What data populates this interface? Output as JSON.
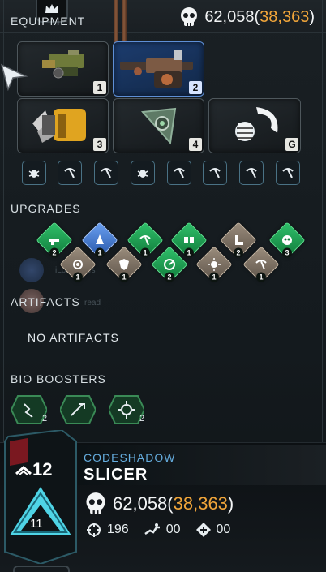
{
  "header": {
    "equipment_title": "EQUIPMENT",
    "currency_main": "62,058",
    "currency_paren_open": "(",
    "currency_secondary": "38,363",
    "currency_paren_close": ")"
  },
  "equipment": {
    "slots": [
      {
        "num": "1",
        "name": "primary-weapon",
        "selected": false
      },
      {
        "num": "2",
        "name": "secondary-weapon",
        "selected": true
      },
      {
        "num": "3",
        "name": "support-equipment",
        "selected": false
      },
      {
        "num": "4",
        "name": "throwable-equipment",
        "selected": false
      },
      {
        "num": "G",
        "name": "grenade",
        "selected": false
      }
    ],
    "mods": [
      "bug-mod-icon",
      "pickaxe-mod-icon",
      "pickaxe-mod-icon",
      "bug-mod-icon",
      "pickaxe-mod-icon",
      "pickaxe-mod-icon",
      "pickaxe-mod-icon",
      "pickaxe-mod-icon"
    ]
  },
  "upgrades": {
    "title": "UPGRADES",
    "items": [
      {
        "color": "green",
        "count": "2"
      },
      {
        "color": "blue",
        "count": "1"
      },
      {
        "color": "green",
        "count": "1"
      },
      {
        "color": "green",
        "count": "1"
      },
      {
        "color": "tan",
        "count": "2"
      },
      {
        "color": "green",
        "count": "3"
      },
      {
        "color": "tan",
        "count": "1"
      },
      {
        "color": "tan",
        "count": "1"
      },
      {
        "color": "green",
        "count": "2"
      },
      {
        "color": "tan",
        "count": "1"
      },
      {
        "color": "tan",
        "count": "1"
      }
    ],
    "ghost_text_1": "iLo...yBees",
    "ghost_text_2": "read"
  },
  "artifacts": {
    "title": "ARTIFACTS",
    "empty_text": "NO ARTIFACTS"
  },
  "bio_boosters": {
    "title": "BIO BOOSTERS",
    "items": [
      {
        "count": "2"
      },
      {
        "count": ""
      },
      {
        "count": "2"
      }
    ]
  },
  "player": {
    "level": "12",
    "rank": "11",
    "class_name": "CODESHADOW",
    "name": "SLICER",
    "currency_main": "62,058",
    "currency_paren_open": "(",
    "currency_secondary": "38,363",
    "currency_paren_close": ")",
    "stat_accuracy": "196",
    "stat_run": "00",
    "stat_heal": "00"
  },
  "colors": {
    "accent_blue": "#66aee0",
    "gold": "#f0a53a",
    "upgrade_green": "#2fbf6a",
    "upgrade_blue": "#6a9ff0",
    "upgrade_tan": "#9a8c7c",
    "rank_cyan": "#4fd4e6"
  }
}
